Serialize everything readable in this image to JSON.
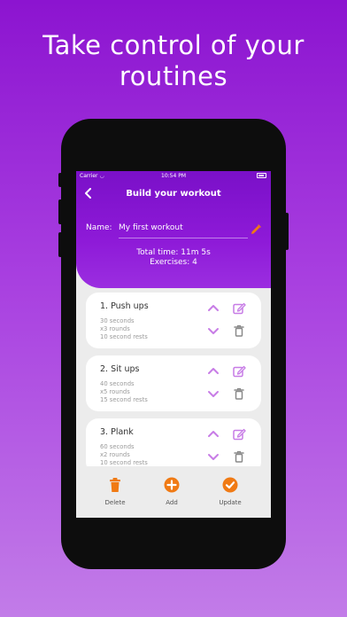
{
  "headline": {
    "line1": "Take control of your",
    "line2": "routines"
  },
  "status_bar": {
    "carrier": "Carrier",
    "time": "10:54 PM"
  },
  "nav": {
    "title": "Build your workout"
  },
  "workout": {
    "name_label": "Name:",
    "name_value": "My first workout",
    "total_time": "Total time: 11m 5s",
    "exercises": "Exercises: 4"
  },
  "exercises": [
    {
      "title": "1. Push ups",
      "duration": "30 seconds",
      "rounds": "x3 rounds",
      "rests": "10 second rests"
    },
    {
      "title": "2. Sit ups",
      "duration": "40 seconds",
      "rounds": "x5 rounds",
      "rests": "15 second rests"
    },
    {
      "title": "3. Plank",
      "duration": "60 seconds",
      "rounds": "x2 rounds",
      "rests": "10 second rests"
    }
  ],
  "bottom_bar": {
    "delete_label": "Delete",
    "add_label": "Add",
    "update_label": "Update"
  },
  "colors": {
    "accent_purple": "#8e1ad8",
    "icon_purple": "#c77ce6",
    "action_orange": "#f07a14",
    "delete_icon": "#8a8a8a"
  },
  "icons": {
    "back": "chevron-left-icon",
    "edit_name": "pencil-icon",
    "move_up": "chevron-up-icon",
    "move_down": "chevron-down-icon",
    "edit": "edit-icon",
    "trash": "trash-icon",
    "delete": "trash-icon",
    "add": "plus-circle-icon",
    "update": "check-circle-icon"
  }
}
